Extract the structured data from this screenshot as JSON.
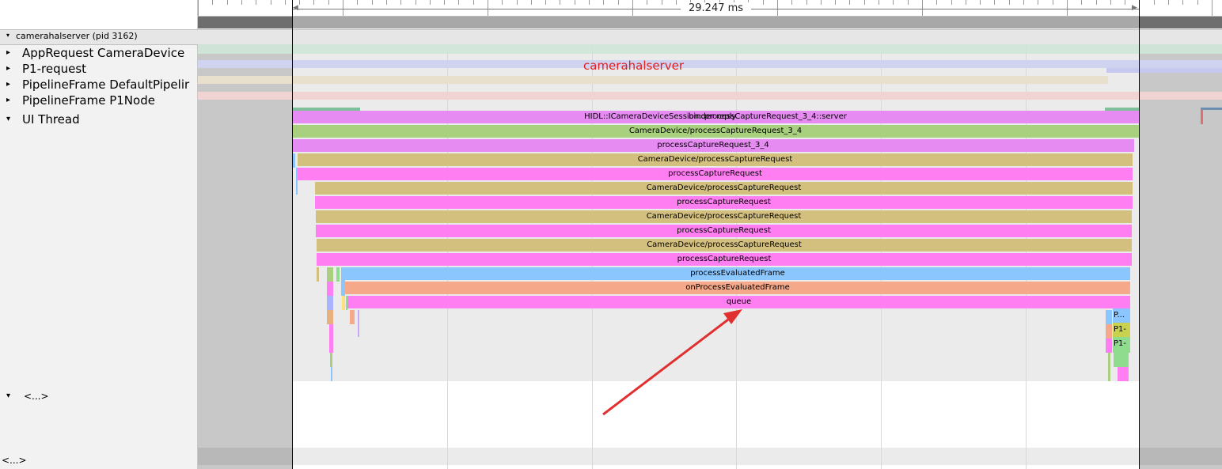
{
  "ruler": {
    "duration_label": "29.247 ms"
  },
  "process": {
    "header": "camerahalserver (pid 3162)",
    "annotation": "camerahalserver"
  },
  "tracks": [
    {
      "label": "AppRequest CameraDevice"
    },
    {
      "label": "P1-request"
    },
    {
      "label": "PipelineFrame DefaultPipelir"
    },
    {
      "label": "PipelineFrame P1Node"
    },
    {
      "label": "UI Thread"
    }
  ],
  "ellipsis": {
    "group_label": "<...>",
    "bottom_label": "<...>"
  },
  "slices": [
    {
      "name": "HIDL::ICameraDeviceSession::processCaptureRequest_3_4::server",
      "overlap": "binder reply",
      "color": "#e58bf2"
    },
    {
      "name": "CameraDevice/processCaptureRequest_3_4",
      "color": "#a8d07e"
    },
    {
      "name": "processCaptureRequest_3_4",
      "color": "#e58bf2"
    },
    {
      "name": "CameraDevice/processCaptureRequest",
      "color": "#d4c07e"
    },
    {
      "name": "processCaptureRequest",
      "color": "#ff7ef2"
    },
    {
      "name": "CameraDevice/processCaptureRequest",
      "color": "#d4c07e"
    },
    {
      "name": "processCaptureRequest",
      "color": "#ff7ef2"
    },
    {
      "name": "CameraDevice/processCaptureRequest",
      "color": "#d4c07e"
    },
    {
      "name": "processCaptureRequest",
      "color": "#ff7ef2"
    },
    {
      "name": "CameraDevice/processCaptureRequest",
      "color": "#d4c07e"
    },
    {
      "name": "processCaptureRequest",
      "color": "#ff7ef2"
    },
    {
      "name": "processEvaluatedFrame",
      "color": "#8cc6ff"
    },
    {
      "name": "onProcessEvaluatedFrame",
      "color": "#f5a98a"
    },
    {
      "name": "queue",
      "color": "#ff7ef2"
    }
  ],
  "small_slices": [
    {
      "name": "P...",
      "color": "#8cc6ff"
    },
    {
      "name": "P1-",
      "color": "#c8d24e"
    },
    {
      "name": "P1-",
      "color": "#8fdc8f"
    }
  ],
  "colors": {
    "arrow": "#e03030",
    "annotation": "#e02020",
    "selection_border": "#000000"
  }
}
